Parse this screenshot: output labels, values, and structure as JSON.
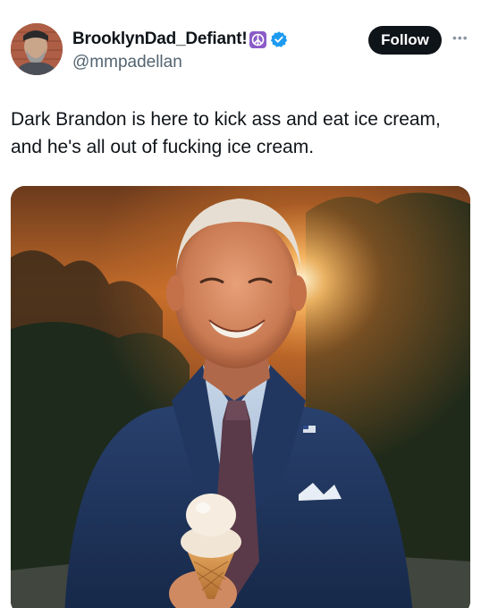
{
  "author": {
    "display_name": "BrooklynDad_Defiant!",
    "handle": "@mmpadellan",
    "badge_icon": "peace-sign-icon",
    "verified_icon": "verified-badge-icon",
    "verified_color": "#1d9bf0"
  },
  "actions": {
    "follow_label": "Follow",
    "more_icon": "more-options-icon"
  },
  "tweet": {
    "text_line1": "Dark Brandon is here to kick ass and eat ice cream,",
    "text_line2": "and he's all out of fucking ice cream."
  },
  "media": {
    "type": "photo"
  },
  "colors": {
    "text": "#0f1419",
    "secondary_text": "#536471",
    "follow_bg": "#0f1419",
    "badge_purple": "#8b5cc8"
  }
}
